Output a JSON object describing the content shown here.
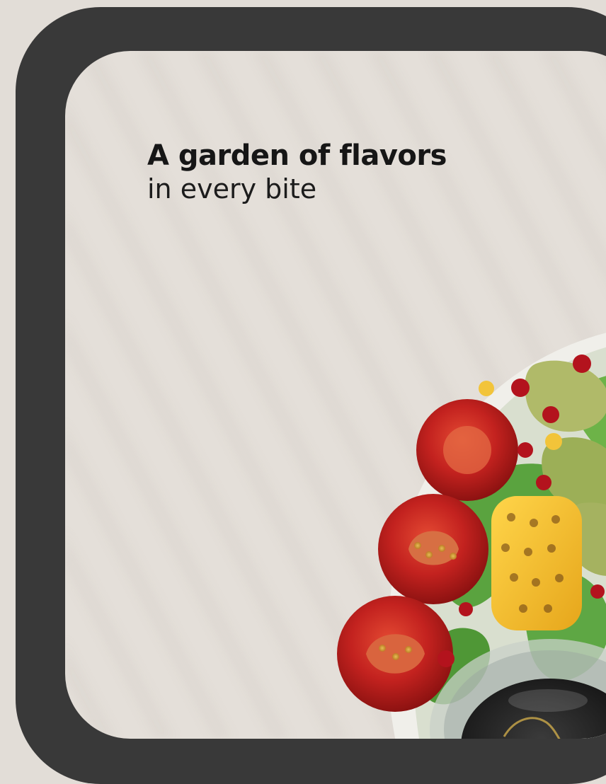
{
  "headline": {
    "title": "A garden of flavors",
    "subtitle": "in every bite"
  },
  "colors": {
    "frame": "#393939",
    "background": "#e2ddd7",
    "card": "#e4dfd9",
    "text": "#161616"
  },
  "image": {
    "subject": "salad-bowl-illustration",
    "icons": [
      "bowl",
      "tomato",
      "corn",
      "avocado",
      "pomegranate",
      "dressing-cup"
    ]
  }
}
